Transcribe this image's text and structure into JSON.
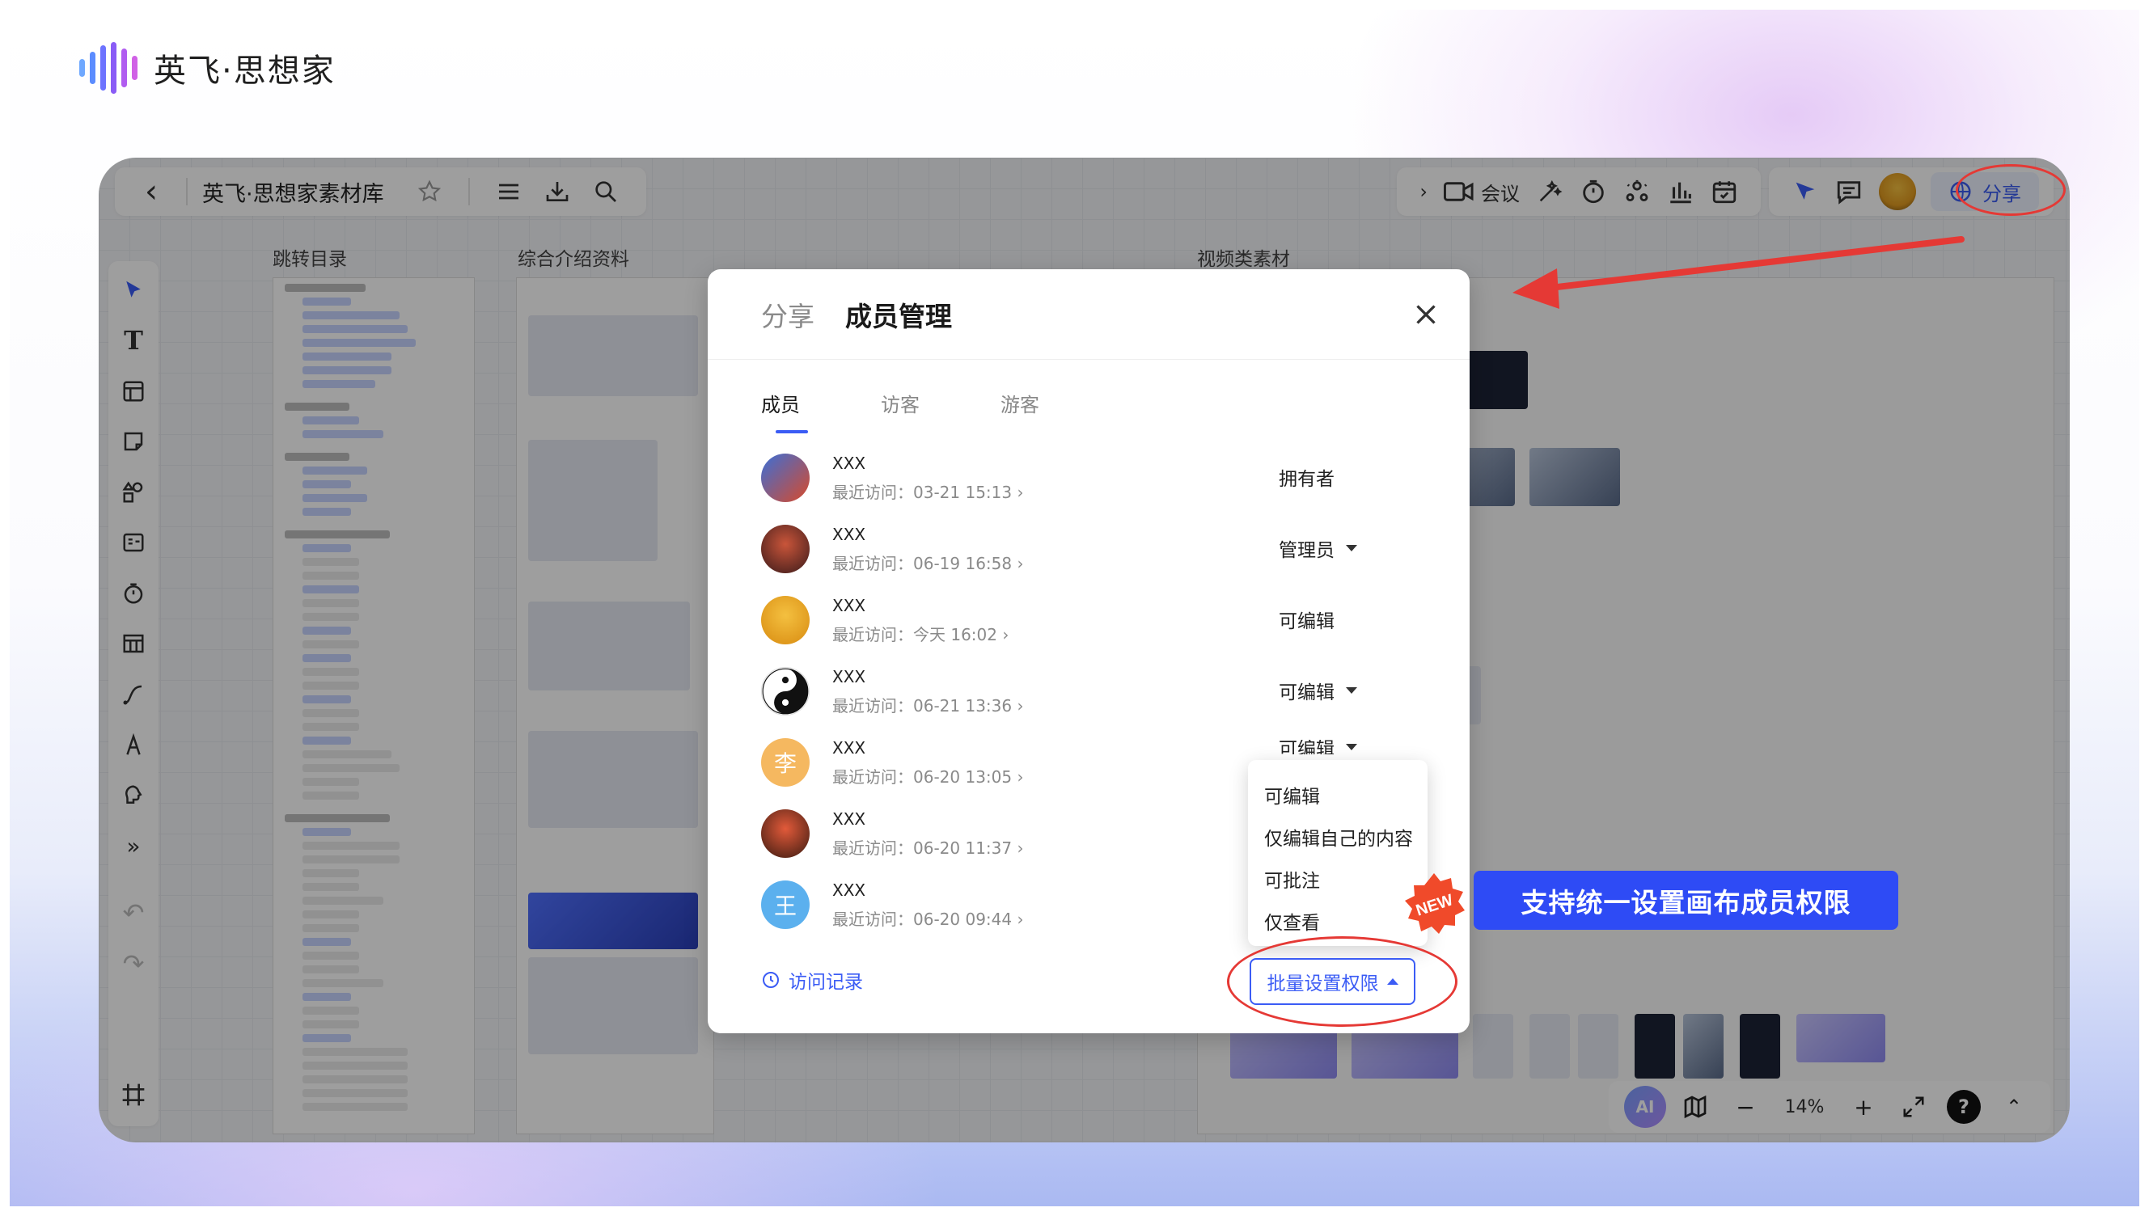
{
  "brand": {
    "name": "英飞·思想家"
  },
  "topbar": {
    "board_title": "英飞·思想家素材库",
    "meeting_label": "会议",
    "share_label": "分享"
  },
  "canvas": {
    "columns": [
      "跳转目录",
      "综合介绍资料",
      "视频类素材"
    ],
    "zoom": "14%",
    "ai_label": "AI"
  },
  "modal": {
    "tab_share": "分享",
    "tab_member": "成员管理",
    "subtabs": [
      "成员",
      "访客",
      "游客"
    ],
    "members": [
      {
        "name": "XXX",
        "visit": "最近访问：03-21 15:13 ›",
        "role": "拥有者",
        "has_dropdown": false
      },
      {
        "name": "XXX",
        "visit": "最近访问：06-19 16:58 ›",
        "role": "管理员",
        "has_dropdown": true
      },
      {
        "name": "XXX",
        "visit": "最近访问：今天 16:02 ›",
        "role": "可编辑",
        "has_dropdown": false
      },
      {
        "name": "XXX",
        "visit": "最近访问：06-21 13:36 ›",
        "role": "可编辑",
        "has_dropdown": true
      },
      {
        "name": "XXX",
        "visit": "最近访问：06-20 13:05 ›",
        "role": "可编辑",
        "has_dropdown": true,
        "avatar_text": "李"
      },
      {
        "name": "XXX",
        "visit": "最近访问：06-20 11:37 ›",
        "role": "",
        "has_dropdown": false
      },
      {
        "name": "XXX",
        "visit": "最近访问：06-20 09:44 ›",
        "role": "",
        "has_dropdown": false,
        "avatar_text": "王"
      }
    ],
    "visit_log": "访问记录",
    "batch_button": "批量设置权限",
    "dropdown_options": [
      "可编辑",
      "仅编辑自己的内容",
      "可批注",
      "仅查看"
    ]
  },
  "annotation": {
    "new_badge": "NEW",
    "banner_text": "支持统一设置画布成员权限"
  },
  "colors": {
    "accent": "#3b5cf5",
    "annotation_red": "#e53935",
    "banner_blue": "#2e4bf5"
  }
}
